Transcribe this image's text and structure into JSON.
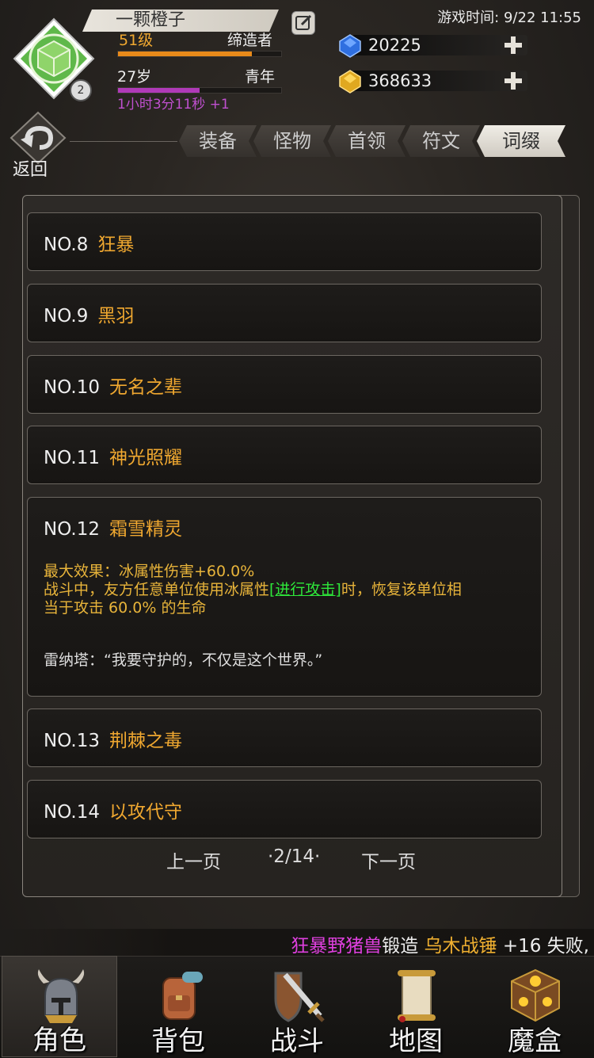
{
  "header": {
    "player_name": "一颗橙子",
    "level_label": "51级",
    "title_label": "缔造者",
    "level_progress": 0.82,
    "age_label": "27岁",
    "age_stage_label": "青年",
    "age_progress": 0.5,
    "age_timer": "1小时3分11秒 +1",
    "avatar_level": "2",
    "game_time": "游戏时间: 9/22 11:55"
  },
  "currency": {
    "diamonds": "20225",
    "gold": "368633"
  },
  "back_label": "返回",
  "tabs": [
    {
      "label": "装备",
      "active": false
    },
    {
      "label": "怪物",
      "active": false
    },
    {
      "label": "首领",
      "active": false
    },
    {
      "label": "符文",
      "active": false
    },
    {
      "label": "词缀",
      "active": true
    }
  ],
  "entries": [
    {
      "no": "NO.8",
      "name": "狂暴"
    },
    {
      "no": "NO.9",
      "name": "黑羽"
    },
    {
      "no": "NO.10",
      "name": "无名之辈"
    },
    {
      "no": "NO.11",
      "name": "神光照耀"
    },
    {
      "no": "NO.12",
      "name": "霜雪精灵",
      "detail": {
        "line1": "最大效果：冰属性伤害+60.0%",
        "line2_pre": "战斗中，友方任意单位使用冰属性",
        "line2_link": "[进行攻击]",
        "line2_post": "时，恢复该单位相",
        "line3": "当于攻击 60.0% 的生命",
        "quote": "雷纳塔：“我要守护的，不仅是这个世界。”"
      }
    },
    {
      "no": "NO.13",
      "name": "荆棘之毒"
    },
    {
      "no": "NO.14",
      "name": "以攻代守"
    }
  ],
  "pager": {
    "prev": "上一页",
    "page": "·2/14·",
    "next": "下一页"
  },
  "ticker": {
    "monster": "狂暴野猪兽",
    "action": "锻造",
    "item": "乌木战锤",
    "result": "+16 失败,"
  },
  "nav": [
    {
      "label": "角色",
      "icon": "helmet-icon",
      "active": true
    },
    {
      "label": "背包",
      "icon": "backpack-icon",
      "active": false
    },
    {
      "label": "战斗",
      "icon": "sword-shield-icon",
      "active": false
    },
    {
      "label": "地图",
      "icon": "scroll-map-icon",
      "active": false
    },
    {
      "label": "魔盒",
      "icon": "magic-box-icon",
      "active": false
    }
  ],
  "colors": {
    "accent_gold": "#f0a830",
    "level_bar": "#e88a1a",
    "age_bar": "#b03ab8",
    "age_timer": "#c050d0",
    "link_green": "#2ee83a",
    "ticker_magenta": "#e040e0",
    "ticker_gold": "#f0b030"
  }
}
